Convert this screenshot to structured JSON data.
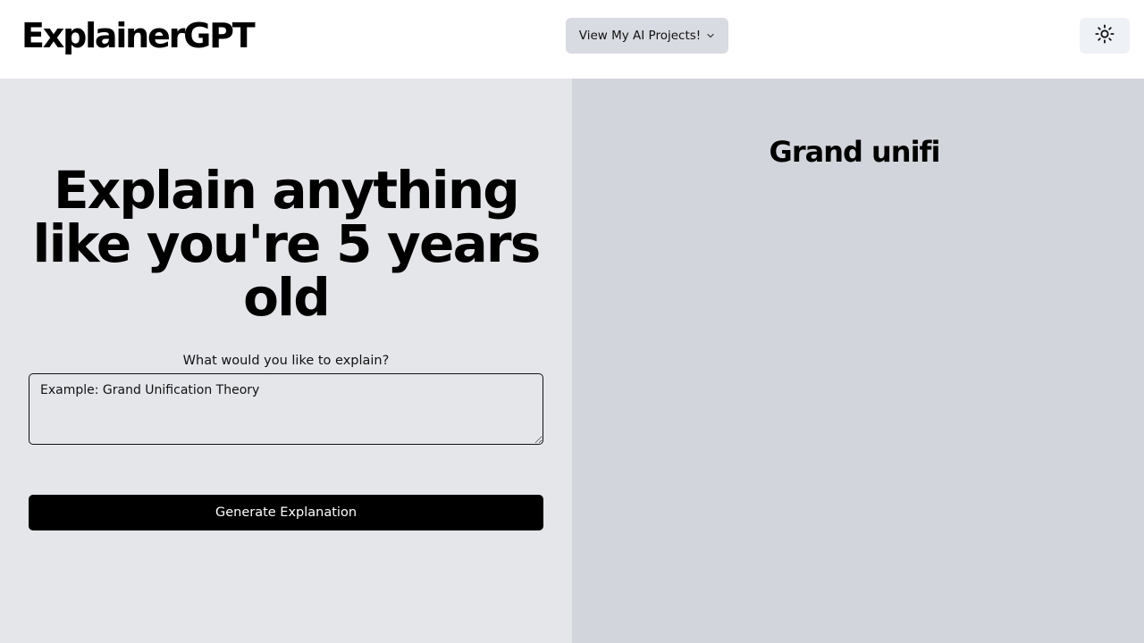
{
  "header": {
    "logo": "ExplainerGPT",
    "projects_button_label": "View My AI Projects!",
    "projects_chevron_icon": "chevron-down-icon",
    "theme_toggle_icon": "sun-icon"
  },
  "form": {
    "headline": "Explain anything like you're 5 years old",
    "prompt_label": "What would you like to explain?",
    "prompt_placeholder": "Example: Grand Unification Theory",
    "prompt_value": "",
    "generate_button_label": "Generate Explanation"
  },
  "result": {
    "title": "Grand unifi"
  },
  "colors": {
    "left_pane_bg": "#e5e6ea",
    "right_pane_bg": "#d2d5db",
    "primary_button": "#000000",
    "projects_button_bg": "#d8dbe1"
  }
}
